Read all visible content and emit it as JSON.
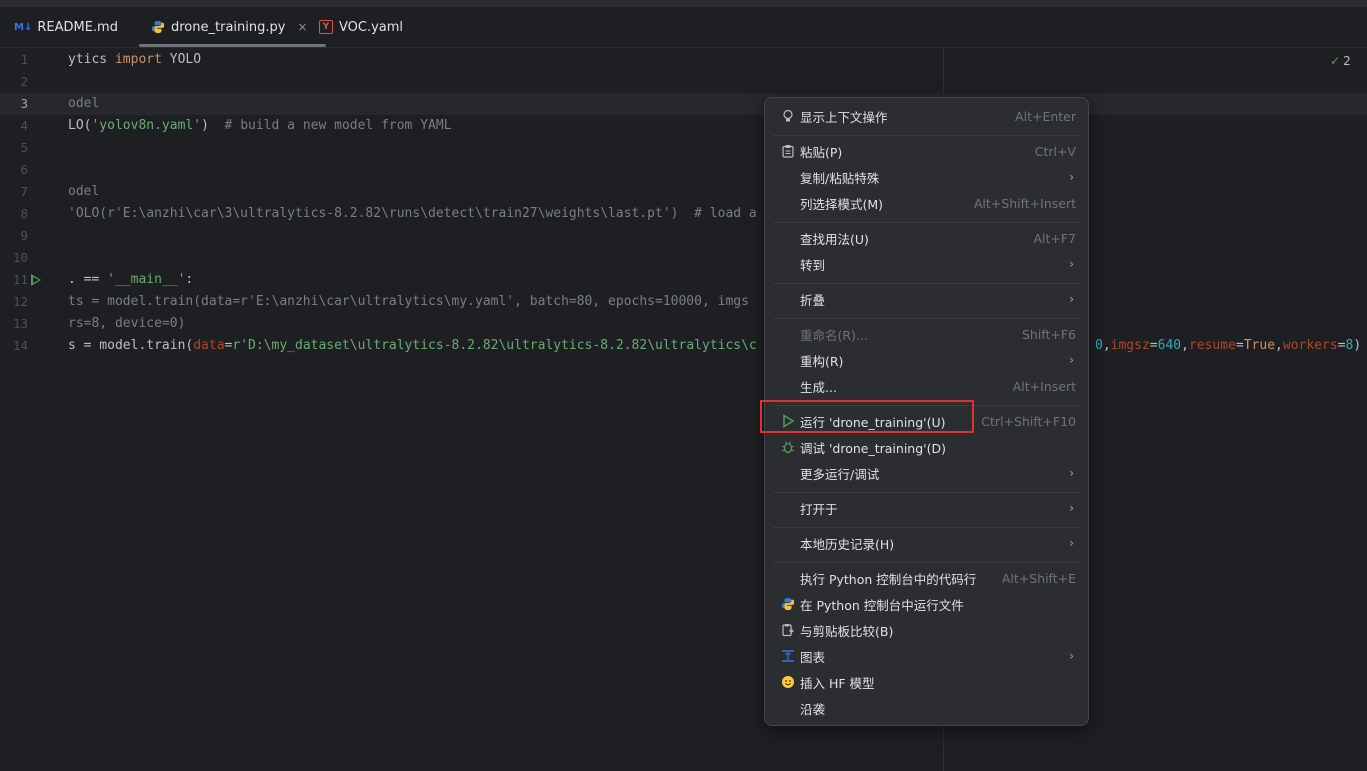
{
  "tabs": [
    {
      "label": "README.md",
      "icon_text": "M↓",
      "icon": "markdown-icon",
      "active": false
    },
    {
      "label": "drone_training.py",
      "icon": "python-icon",
      "active": true
    },
    {
      "label": "VOC.yaml",
      "icon_text": "Y",
      "icon": "yaml-icon",
      "active": false
    }
  ],
  "tab_close_glyph": "×",
  "inspection": {
    "count": "2",
    "icon": "check-icon"
  },
  "code_lines": [
    {
      "n": "1",
      "segs": [
        [
          "ytics ",
          "plain"
        ],
        [
          "import",
          "kw"
        ],
        [
          " YOLO",
          "plain"
        ]
      ]
    },
    {
      "n": "2",
      "segs": []
    },
    {
      "n": "3",
      "segs": [
        [
          "odel",
          "cmt"
        ]
      ],
      "current": true
    },
    {
      "n": "4",
      "segs": [
        [
          "LO(",
          "plain"
        ],
        [
          "'yolov8n.yaml'",
          "str"
        ],
        [
          ")  ",
          "plain"
        ],
        [
          "# build a new model from YAML",
          "cmt"
        ]
      ]
    },
    {
      "n": "5",
      "segs": []
    },
    {
      "n": "6",
      "segs": []
    },
    {
      "n": "7",
      "segs": [
        [
          "odel",
          "cmt"
        ]
      ]
    },
    {
      "n": "8",
      "segs": [
        [
          "'OLO(r'E:\\anzhi\\car\\3\\ultralytics-8.2.82\\runs\\detect\\train27\\weights\\last.pt')  # load a",
          "cmt"
        ]
      ]
    },
    {
      "n": "9",
      "segs": []
    },
    {
      "n": "10",
      "segs": []
    },
    {
      "n": "11",
      "segs": [
        [
          ". == ",
          "plain"
        ],
        [
          "'__main__'",
          "str"
        ],
        [
          ":",
          "plain"
        ]
      ],
      "run": true
    },
    {
      "n": "12",
      "segs": [
        [
          "ts = model.train(data=r'E:\\anzhi\\car\\ultralytics\\my.yaml', batch=80, epochs=10000, imgs",
          "cmt"
        ]
      ]
    },
    {
      "n": "13",
      "segs": [
        [
          "rs=8, device=0)",
          "cmt"
        ]
      ]
    },
    {
      "n": "14",
      "segs": [
        [
          "s = model.train(",
          "plain"
        ],
        [
          "data",
          "param"
        ],
        [
          "=",
          "plain"
        ],
        [
          "r'D:\\my_dataset\\ultralytics-8.2.82\\ultralytics-8.2.82\\ultralytics\\c",
          "str"
        ]
      ]
    }
  ],
  "line14_tail": [
    [
      "0",
      "num"
    ],
    [
      ",",
      "plain"
    ],
    [
      "imgsz",
      "param"
    ],
    [
      "=",
      "plain"
    ],
    [
      "640",
      "num"
    ],
    [
      ",",
      "plain"
    ],
    [
      "resume",
      "param"
    ],
    [
      "=",
      "plain"
    ],
    [
      "True",
      "kw"
    ],
    [
      ",",
      "plain"
    ],
    [
      "workers",
      "param"
    ],
    [
      "=",
      "plain"
    ],
    [
      "8",
      "num"
    ],
    [
      ")",
      "plain"
    ]
  ],
  "menu": {
    "items": [
      {
        "label": "显示上下文操作",
        "shortcut": "Alt+Enter",
        "icon": "lightbulb-icon"
      },
      {
        "sep": true
      },
      {
        "label": "粘贴(P)",
        "shortcut": "Ctrl+V",
        "icon": "clipboard-icon"
      },
      {
        "label": "复制/粘贴特殊",
        "submenu": true
      },
      {
        "label": "列选择模式(M)",
        "shortcut": "Alt+Shift+Insert"
      },
      {
        "sep": true
      },
      {
        "label": "查找用法(U)",
        "shortcut": "Alt+F7"
      },
      {
        "label": "转到",
        "submenu": true
      },
      {
        "sep": true
      },
      {
        "label": "折叠",
        "submenu": true
      },
      {
        "sep": true
      },
      {
        "label": "重命名(R)...",
        "shortcut": "Shift+F6",
        "disabled": true
      },
      {
        "label": "重构(R)",
        "submenu": true
      },
      {
        "label": "生成...",
        "shortcut": "Alt+Insert"
      },
      {
        "sep": true
      },
      {
        "label": "运行 'drone_training'(U)",
        "shortcut": "Ctrl+Shift+F10",
        "icon": "run-icon"
      },
      {
        "label": "调试 'drone_training'(D)",
        "icon": "debug-bug-icon"
      },
      {
        "label": "更多运行/调试",
        "submenu": true
      },
      {
        "sep": true
      },
      {
        "label": "打开于",
        "submenu": true
      },
      {
        "sep": true
      },
      {
        "label": "本地历史记录(H)",
        "submenu": true
      },
      {
        "sep": true
      },
      {
        "label": "执行 Python 控制台中的代码行",
        "shortcut": "Alt+Shift+E"
      },
      {
        "label": "在 Python 控制台中运行文件",
        "icon": "python-icon"
      },
      {
        "label": "与剪贴板比较(B)",
        "icon": "compare-clipboard-icon"
      },
      {
        "label": "图表",
        "submenu": true,
        "icon": "diagram-icon"
      },
      {
        "label": "插入 HF 模型",
        "icon": "huggingface-icon"
      },
      {
        "label": "沿袭"
      }
    ]
  },
  "colors": {
    "highlight_box": "#e03131",
    "run_green": "#57965c"
  }
}
